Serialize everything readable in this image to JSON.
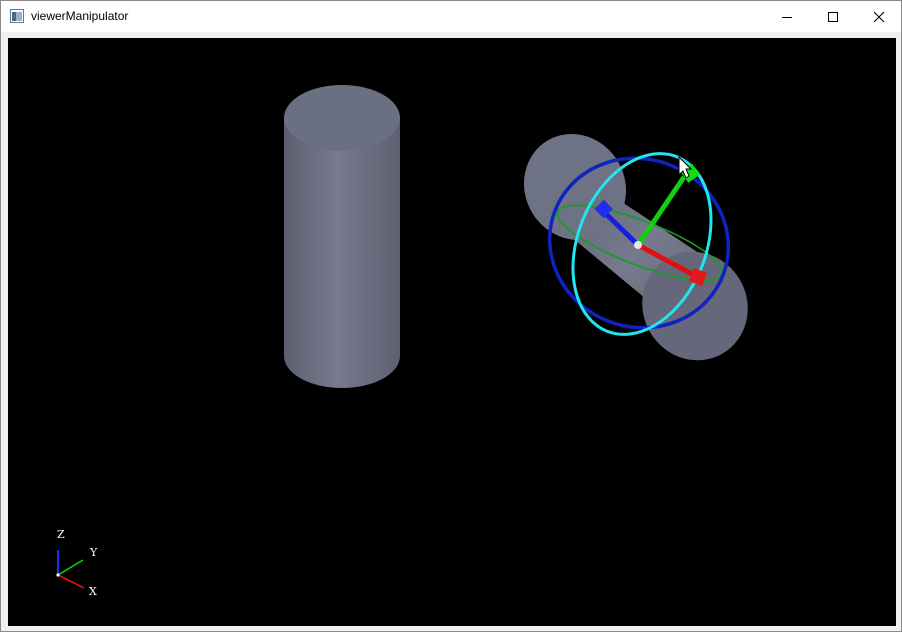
{
  "window": {
    "title": "viewerManipulator"
  },
  "titlebar_controls": {
    "minimize": "minimize-icon",
    "maximize": "maximize-icon",
    "close": "close-icon"
  },
  "axis_triad": {
    "z_label": "Z",
    "y_label": "Y",
    "x_label": "X"
  },
  "colors": {
    "background": "#000000",
    "cylinder": "#6e7285",
    "x_axis": "#e01010",
    "y_axis": "#10d010",
    "z_axis": "#1020e0",
    "ring_cyan": "#20e8f0",
    "ring_blue": "#1020c8",
    "ring_green": "#10a020"
  }
}
